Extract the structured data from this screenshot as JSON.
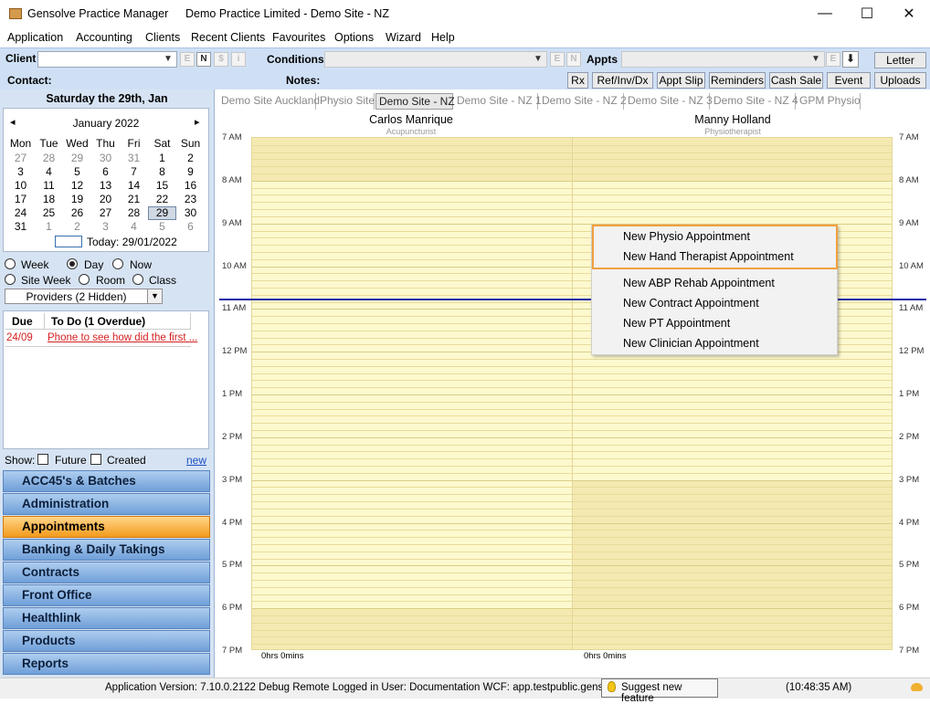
{
  "title_bar": {
    "app_title": "Gensolve Practice Manager",
    "document_title": "Demo Practice Limited  - Demo Site - NZ",
    "minimize": "—",
    "maximize": "☐",
    "close": "✕"
  },
  "menu": [
    "Application",
    "Accounting",
    "Clients",
    "Recent Clients",
    "Favourites",
    "Options",
    "Wizard",
    "Help"
  ],
  "toolbar": {
    "client_label": "Client",
    "contact_label": "Contact:",
    "conditions_label": "Conditions",
    "notes_label": "Notes:",
    "appts_label": "Appts",
    "client_small_buttons": [
      "E",
      "N",
      "$",
      "i"
    ],
    "conditions_small_buttons": [
      "E",
      "N"
    ],
    "appts_small_button": "E",
    "download_glyph": "⬇",
    "letter_button": "Letter",
    "action_buttons": [
      "Rx",
      "Ref/Inv/Dx",
      "Appt Slip",
      "Reminders",
      "Cash Sale",
      "Event",
      "Uploads"
    ]
  },
  "left_panel": {
    "date_heading": "Saturday the 29th, Jan",
    "calendar": {
      "month_label": "January 2022",
      "prev": "◂",
      "next": "▸",
      "weekdays": [
        "Mon",
        "Tue",
        "Wed",
        "Thu",
        "Fri",
        "Sat",
        "Sun"
      ],
      "weeks": [
        [
          "27",
          "28",
          "29",
          "30",
          "31",
          "1",
          "2"
        ],
        [
          "3",
          "4",
          "5",
          "6",
          "7",
          "8",
          "9"
        ],
        [
          "10",
          "11",
          "12",
          "13",
          "14",
          "15",
          "16"
        ],
        [
          "17",
          "18",
          "19",
          "20",
          "21",
          "22",
          "23"
        ],
        [
          "24",
          "25",
          "26",
          "27",
          "28",
          "29",
          "30"
        ],
        [
          "31",
          "1",
          "2",
          "3",
          "4",
          "5",
          "6"
        ]
      ],
      "selected_day": "29",
      "today_label": "Today: 29/01/2022"
    },
    "view_options": {
      "row1": [
        "Week",
        "Day",
        "Now"
      ],
      "row2": [
        "Site Week",
        "Room",
        "Class"
      ],
      "selected": "Day"
    },
    "providers_select": "Providers (2 Hidden)",
    "todo": {
      "col_due": "Due",
      "col_todo": "To Do (1 Overdue)",
      "items": [
        {
          "due": "24/09",
          "text": "Phone to see how did the first ..."
        }
      ]
    },
    "show_filter": {
      "label": "Show:",
      "future": "Future",
      "created": "Created",
      "new_link": "new"
    },
    "nav_buttons": [
      "ACC45's & Batches",
      "Administration",
      "Appointments",
      "Banking & Daily Takings",
      "Contracts",
      "Front Office",
      "Healthlink",
      "Products",
      "Reports"
    ],
    "active_nav": "Appointments"
  },
  "tabs": [
    "Demo Site Auckland",
    "Physio Site",
    "Demo Site - NZ",
    "Demo Site - NZ 1",
    "Demo Site - NZ 2",
    "Demo Site - NZ 3",
    "Demo Site - NZ 4",
    "GPM Physio"
  ],
  "active_tab": "Demo Site - NZ",
  "schedule": {
    "providers": [
      {
        "name": "Carlos Manrique",
        "role": "Acupuncturist",
        "total": "0hrs 0mins"
      },
      {
        "name": "Manny Holland",
        "role": "Physiotherapist",
        "total": "0hrs 0mins"
      }
    ],
    "hours": [
      "7 AM",
      "8 AM",
      "9 AM",
      "10 AM",
      "11 AM",
      "12 PM",
      "1 PM",
      "2 PM",
      "3 PM",
      "4 PM",
      "5 PM",
      "6 PM",
      "7 PM"
    ]
  },
  "context_menu": {
    "items": [
      "New Physio Appointment",
      "New Hand Therapist Appointment",
      "New ABP Rehab Appointment",
      "New Contract Appointment",
      "New PT Appointment",
      "New Clinician Appointment"
    ]
  },
  "status_bar": {
    "version": "Application Version: 7.10.0.2122 Debug Remote  Logged in User: Documentation WCF: app.testpublic.gensolve.com",
    "suggest_button": "Suggest new feature",
    "time": "(10:48:35 AM)"
  },
  "colors": {
    "slot_available": "#fdf9cf",
    "slot_unavailable": "#f5e9b2",
    "current_time_line": "#1a2aa8",
    "nav_active": "#f39a1c",
    "overdue_red": "#d42020",
    "menu_highlight_border": "#f0a040"
  }
}
